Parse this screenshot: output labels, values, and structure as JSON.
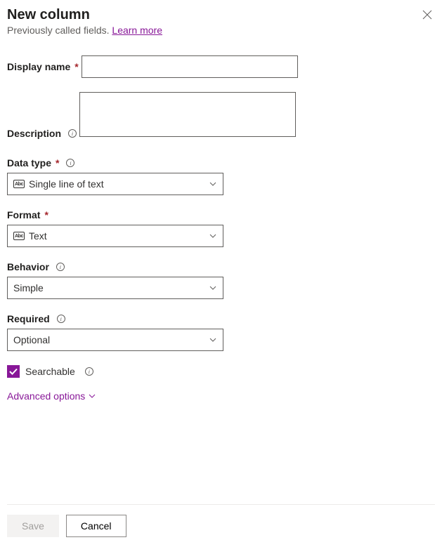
{
  "header": {
    "title": "New column",
    "subtitle_prefix": "Previously called fields. ",
    "learn_more": "Learn more"
  },
  "fields": {
    "display_name": {
      "label": "Display name",
      "value": ""
    },
    "description": {
      "label": "Description",
      "value": ""
    },
    "data_type": {
      "label": "Data type",
      "selected": "Single line of text"
    },
    "format": {
      "label": "Format",
      "selected": "Text"
    },
    "behavior": {
      "label": "Behavior",
      "selected": "Simple"
    },
    "required": {
      "label": "Required",
      "selected": "Optional"
    },
    "searchable": {
      "label": "Searchable",
      "checked": true
    }
  },
  "advanced_label": "Advanced options",
  "footer": {
    "save": "Save",
    "cancel": "Cancel"
  }
}
